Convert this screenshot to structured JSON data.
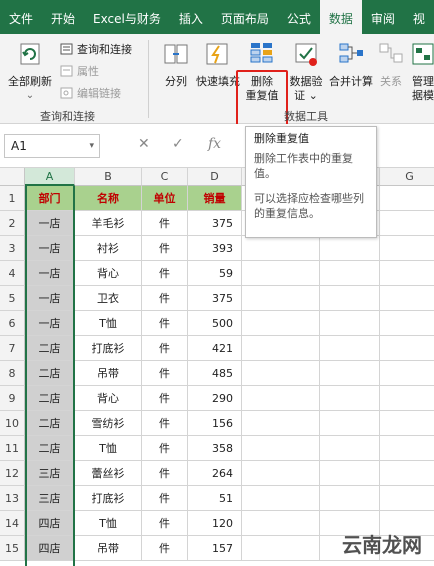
{
  "tabs": [
    "文件",
    "开始",
    "Excel与财务",
    "插入",
    "页面布局",
    "公式",
    "数据",
    "审阅",
    "视"
  ],
  "active_tab_index": 6,
  "ribbon": {
    "refresh_all": "全部刷新",
    "refresh_dd": "⌄",
    "queries": "查询和连接",
    "properties": "属性",
    "edit_links": "编辑链接",
    "group_queries": "查询和连接",
    "text_to_columns": "分列",
    "flash_fill": "快速填充",
    "remove_dup_line1": "删除",
    "remove_dup_line2": "重复值",
    "data_validation_line1": "数据验",
    "data_validation_line2": "证 ⌄",
    "consolidate": "合并计算",
    "relationships": "关系",
    "manage_line1": "管理",
    "manage_line2": "据模",
    "group_tools": "数据工具"
  },
  "formula_bar": {
    "name_box": "A1",
    "dd": "▾",
    "cancel": "✕",
    "enter": "✓",
    "fx": "fx"
  },
  "tooltip": {
    "title": "删除重复值",
    "line1": "删除工作表中的重复值。",
    "line2": "可以选择应检查哪些列的重复信息。"
  },
  "columns": [
    "A",
    "B",
    "C",
    "D",
    "E",
    "F",
    "G"
  ],
  "headers": [
    "部门",
    "名称",
    "单位",
    "销量"
  ],
  "rows": [
    {
      "n": "2",
      "dept": "一店",
      "name": "羊毛衫",
      "unit": "件",
      "qty": "375"
    },
    {
      "n": "3",
      "dept": "一店",
      "name": "衬衫",
      "unit": "件",
      "qty": "393"
    },
    {
      "n": "4",
      "dept": "一店",
      "name": "背心",
      "unit": "件",
      "qty": "59"
    },
    {
      "n": "5",
      "dept": "一店",
      "name": "卫衣",
      "unit": "件",
      "qty": "375"
    },
    {
      "n": "6",
      "dept": "一店",
      "name": "T恤",
      "unit": "件",
      "qty": "500"
    },
    {
      "n": "7",
      "dept": "二店",
      "name": "打底衫",
      "unit": "件",
      "qty": "421"
    },
    {
      "n": "8",
      "dept": "二店",
      "name": "吊带",
      "unit": "件",
      "qty": "485"
    },
    {
      "n": "9",
      "dept": "二店",
      "name": "背心",
      "unit": "件",
      "qty": "290"
    },
    {
      "n": "10",
      "dept": "二店",
      "name": "雪纺衫",
      "unit": "件",
      "qty": "156"
    },
    {
      "n": "11",
      "dept": "二店",
      "name": "T恤",
      "unit": "件",
      "qty": "358"
    },
    {
      "n": "12",
      "dept": "三店",
      "name": "蕾丝衫",
      "unit": "件",
      "qty": "264"
    },
    {
      "n": "13",
      "dept": "三店",
      "name": "打底衫",
      "unit": "件",
      "qty": "51"
    },
    {
      "n": "14",
      "dept": "四店",
      "name": "T恤",
      "unit": "件",
      "qty": "120"
    },
    {
      "n": "15",
      "dept": "四店",
      "name": "吊带",
      "unit": "件",
      "qty": "157"
    }
  ],
  "header_row_number": "1",
  "watermark": "云南龙网",
  "colors": {
    "accent": "#217346",
    "header_fill": "#a9d18e",
    "header_text": "#c00000",
    "highlight": "#e0201a"
  }
}
